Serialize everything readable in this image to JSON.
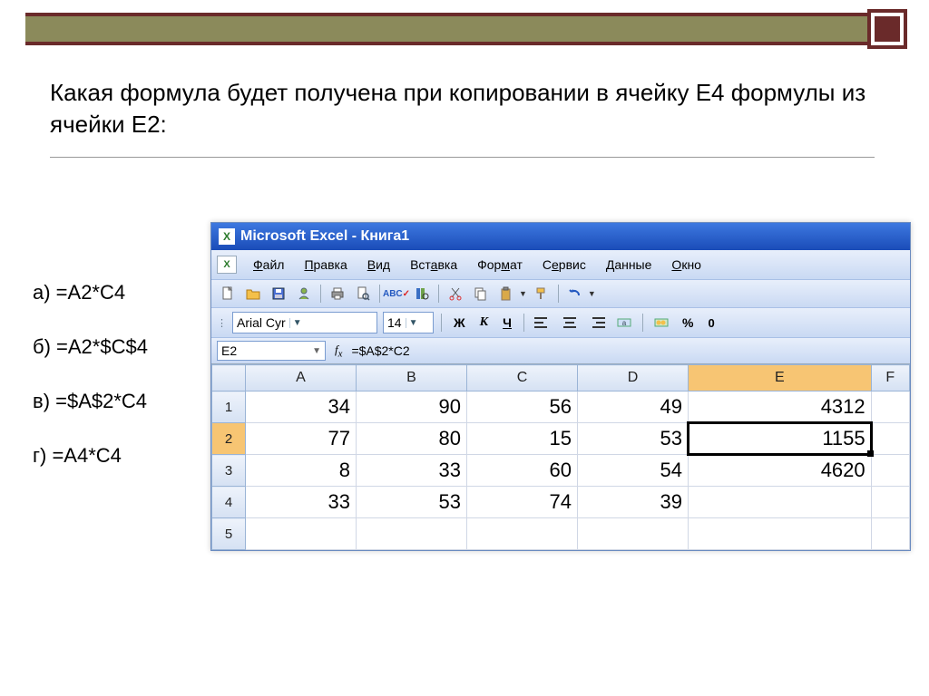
{
  "question": "Какая формула будет получена при копировании в ячейку Е4 формулы из ячейки Е2:",
  "answers": {
    "a": "а) =А2*С4",
    "b": "б) =А2*$C$4",
    "c": "в) =$A$2*С4",
    "d": "г) =А4*С4"
  },
  "titlebar": "Microsoft Excel - Книга1",
  "menu": {
    "file": "Файл",
    "edit": "Правка",
    "view": "Вид",
    "insert": "Вставка",
    "format": "Формат",
    "tools": "Сервис",
    "data": "Данные",
    "window": "Окно"
  },
  "format_toolbar": {
    "font": "Arial Cyr",
    "size": "14",
    "bold": "Ж",
    "italic": "К",
    "underline": "Ч",
    "percent": "%",
    "zero": "0"
  },
  "namebox": "E2",
  "formula": "=$A$2*C2",
  "columns": [
    "A",
    "B",
    "C",
    "D",
    "E",
    "F"
  ],
  "rows": [
    {
      "n": "1",
      "A": "34",
      "B": "90",
      "C": "56",
      "D": "49",
      "E": "4312",
      "F": ""
    },
    {
      "n": "2",
      "A": "77",
      "B": "80",
      "C": "15",
      "D": "53",
      "E": "1155",
      "F": ""
    },
    {
      "n": "3",
      "A": "8",
      "B": "33",
      "C": "60",
      "D": "54",
      "E": "4620",
      "F": ""
    },
    {
      "n": "4",
      "A": "33",
      "B": "53",
      "C": "74",
      "D": "39",
      "E": "",
      "F": ""
    },
    {
      "n": "5",
      "A": "",
      "B": "",
      "C": "",
      "D": "",
      "E": "",
      "F": ""
    }
  ],
  "selected_cell": "E2"
}
